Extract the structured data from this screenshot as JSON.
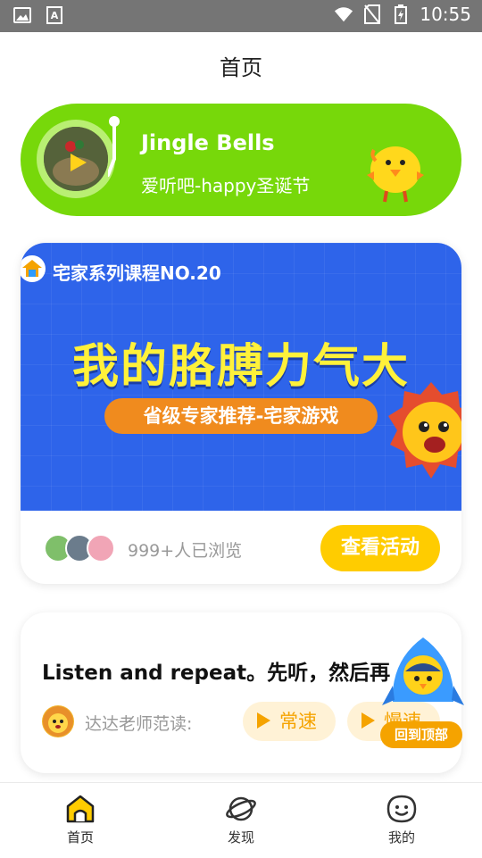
{
  "status_bar": {
    "time": "10:55",
    "icons": [
      "image-icon",
      "a-icon",
      "wifi-icon",
      "no-sim-icon",
      "battery-charging-icon"
    ]
  },
  "header": {
    "title": "首页"
  },
  "player": {
    "song_title": "Jingle Bells",
    "album": "爱听吧-happy圣诞节"
  },
  "activity_card": {
    "series": "宅家系列课程NO.20",
    "headline": "我的胳膊力气大",
    "ribbon": "省级专家推荐-宅家游戏",
    "viewers": "999+人已浏览",
    "button_label": "查看活动"
  },
  "practice_card": {
    "prompt": "Listen and repeat。先听，然后再",
    "teacher_label": "达达老师范读:",
    "normal_speed": "常速",
    "slow_speed": "慢速"
  },
  "floating": {
    "back_to_top": "回到顶部"
  },
  "tabbar": {
    "tabs": [
      {
        "label": "首页",
        "icon": "home-icon",
        "active": true
      },
      {
        "label": "发现",
        "icon": "planet-icon",
        "active": false
      },
      {
        "label": "我的",
        "icon": "face-icon",
        "active": false
      }
    ]
  },
  "colors": {
    "accent_yellow": "#ffcc00",
    "player_green": "#77d80a",
    "banner_blue": "#2e64ea",
    "orange": "#f5a300",
    "status_bar": "#757575"
  }
}
